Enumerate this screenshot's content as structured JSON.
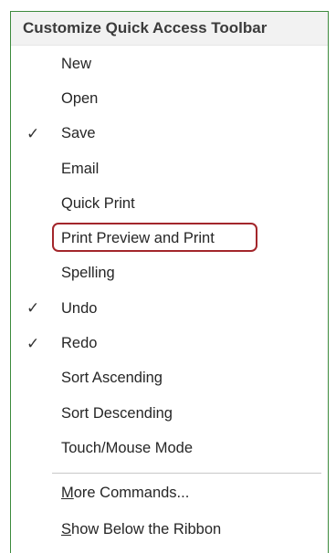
{
  "menu": {
    "title": "Customize Quick Access Toolbar",
    "items": [
      {
        "label": "New",
        "checked": false
      },
      {
        "label": "Open",
        "checked": false
      },
      {
        "label": "Save",
        "checked": true
      },
      {
        "label": "Email",
        "checked": false
      },
      {
        "label": "Quick Print",
        "checked": false
      },
      {
        "label": "Print Preview and Print",
        "checked": false,
        "highlighted": true
      },
      {
        "label": "Spelling",
        "checked": false
      },
      {
        "label": "Undo",
        "checked": true
      },
      {
        "label": "Redo",
        "checked": true
      },
      {
        "label": "Sort Ascending",
        "checked": false
      },
      {
        "label": "Sort Descending",
        "checked": false
      },
      {
        "label": "Touch/Mouse Mode",
        "checked": false
      }
    ],
    "check_glyph": "✓",
    "footer": {
      "more_commands": {
        "accel": "M",
        "rest": "ore Commands..."
      },
      "show_below": {
        "accel": "S",
        "rest": "how Below the Ribbon"
      }
    },
    "colors": {
      "highlight_border": "#a3262b",
      "menu_border": "#3c8a3c",
      "header_bg": "#f2f2f2"
    }
  }
}
